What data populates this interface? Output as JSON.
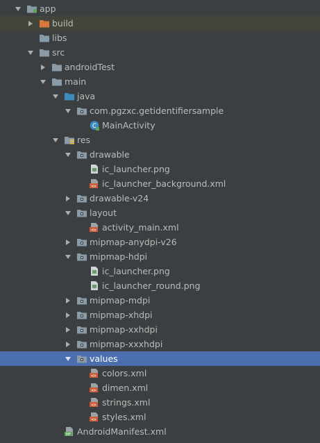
{
  "tree": {
    "items": [
      {
        "label": "app",
        "depth": 0,
        "arrow": "expanded",
        "icon": "module-folder-icon",
        "state": "normal"
      },
      {
        "label": "build",
        "depth": 1,
        "arrow": "collapsed",
        "icon": "excluded-folder-icon",
        "state": "highlight"
      },
      {
        "label": "libs",
        "depth": 1,
        "arrow": "none",
        "icon": "folder-icon",
        "state": "normal"
      },
      {
        "label": "src",
        "depth": 1,
        "arrow": "expanded",
        "icon": "folder-icon",
        "state": "normal"
      },
      {
        "label": "androidTest",
        "depth": 2,
        "arrow": "collapsed",
        "icon": "folder-icon",
        "state": "normal"
      },
      {
        "label": "main",
        "depth": 2,
        "arrow": "expanded",
        "icon": "folder-icon",
        "state": "normal"
      },
      {
        "label": "java",
        "depth": 3,
        "arrow": "expanded",
        "icon": "source-folder-icon",
        "state": "normal"
      },
      {
        "label": "com.pgzxc.getidentifiersample",
        "depth": 4,
        "arrow": "expanded",
        "icon": "package-icon",
        "state": "normal"
      },
      {
        "label": "MainActivity",
        "depth": 5,
        "arrow": "none",
        "icon": "activity-class-icon",
        "state": "normal"
      },
      {
        "label": "res",
        "depth": 3,
        "arrow": "expanded",
        "icon": "resource-folder-icon",
        "state": "normal"
      },
      {
        "label": "drawable",
        "depth": 4,
        "arrow": "expanded",
        "icon": "package-icon",
        "state": "normal"
      },
      {
        "label": "ic_launcher.png",
        "depth": 5,
        "arrow": "none",
        "icon": "image-file-icon",
        "state": "normal"
      },
      {
        "label": "ic_launcher_background.xml",
        "depth": 5,
        "arrow": "none",
        "icon": "xml-file-icon",
        "state": "normal"
      },
      {
        "label": "drawable-v24",
        "depth": 4,
        "arrow": "collapsed",
        "icon": "package-icon",
        "state": "normal"
      },
      {
        "label": "layout",
        "depth": 4,
        "arrow": "expanded",
        "icon": "package-icon",
        "state": "normal"
      },
      {
        "label": "activity_main.xml",
        "depth": 5,
        "arrow": "none",
        "icon": "xml-file-icon",
        "state": "normal"
      },
      {
        "label": "mipmap-anydpi-v26",
        "depth": 4,
        "arrow": "collapsed",
        "icon": "package-icon",
        "state": "normal"
      },
      {
        "label": "mipmap-hdpi",
        "depth": 4,
        "arrow": "expanded",
        "icon": "package-icon",
        "state": "normal"
      },
      {
        "label": "ic_launcher.png",
        "depth": 5,
        "arrow": "none",
        "icon": "image-file-icon",
        "state": "normal"
      },
      {
        "label": "ic_launcher_round.png",
        "depth": 5,
        "arrow": "none",
        "icon": "image-file-icon",
        "state": "normal"
      },
      {
        "label": "mipmap-mdpi",
        "depth": 4,
        "arrow": "collapsed",
        "icon": "package-icon",
        "state": "normal"
      },
      {
        "label": "mipmap-xhdpi",
        "depth": 4,
        "arrow": "collapsed",
        "icon": "package-icon",
        "state": "normal"
      },
      {
        "label": "mipmap-xxhdpi",
        "depth": 4,
        "arrow": "collapsed",
        "icon": "package-icon",
        "state": "normal"
      },
      {
        "label": "mipmap-xxxhdpi",
        "depth": 4,
        "arrow": "collapsed",
        "icon": "package-icon",
        "state": "normal"
      },
      {
        "label": "values",
        "depth": 4,
        "arrow": "expanded",
        "icon": "package-icon",
        "state": "selected"
      },
      {
        "label": "colors.xml",
        "depth": 5,
        "arrow": "none",
        "icon": "xml-file-icon",
        "state": "normal"
      },
      {
        "label": "dimen.xml",
        "depth": 5,
        "arrow": "none",
        "icon": "xml-file-icon",
        "state": "normal"
      },
      {
        "label": "strings.xml",
        "depth": 5,
        "arrow": "none",
        "icon": "xml-file-icon",
        "state": "normal"
      },
      {
        "label": "styles.xml",
        "depth": 5,
        "arrow": "none",
        "icon": "xml-file-icon",
        "state": "normal"
      },
      {
        "label": "AndroidManifest.xml",
        "depth": 3,
        "arrow": "none",
        "icon": "manifest-file-icon",
        "state": "normal"
      }
    ]
  },
  "colors": {
    "background": "#3c3f41",
    "text": "#bbbbbb",
    "selection": "#4b6eaf",
    "highlight": "#43443a",
    "folder": "#8a9ba8",
    "excluded_folder": "#d9773b",
    "source_folder": "#3c8dbd",
    "xml_red": "#cc5e3d"
  }
}
